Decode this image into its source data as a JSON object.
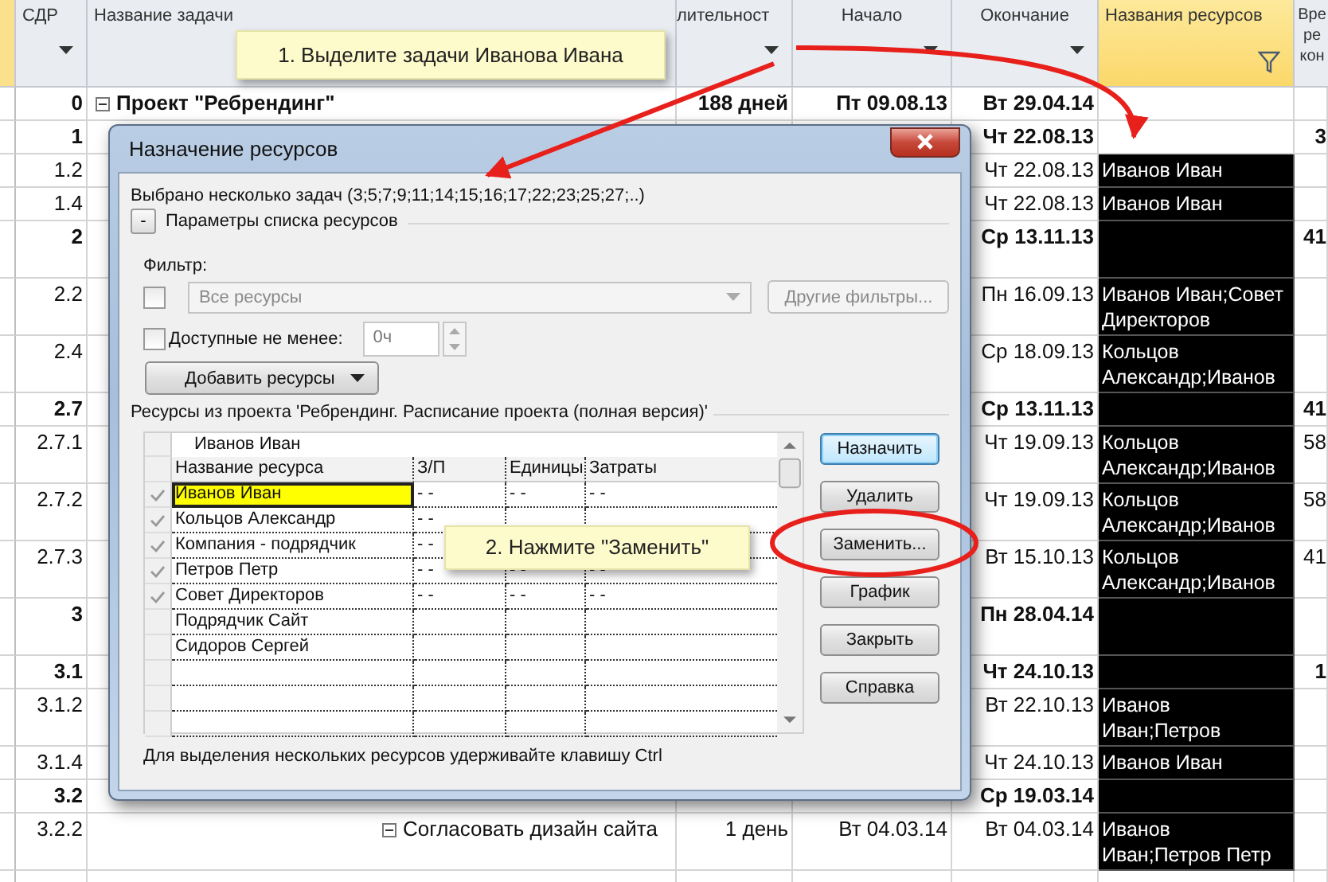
{
  "columns": [
    {
      "kind": "corner"
    },
    {
      "kind": "wbs",
      "label": "СДР",
      "menu": true
    },
    {
      "kind": "name",
      "label": "Название задачи"
    },
    {
      "kind": "duration",
      "label": "лительност",
      "menu": true
    },
    {
      "kind": "start",
      "label": "Начало",
      "menu": true
    },
    {
      "kind": "end",
      "label": "Окончание",
      "menu": true
    },
    {
      "kind": "resources",
      "label": "Названия ресурсов",
      "filtered": true
    },
    {
      "kind": "extra",
      "label": "Вре ре кон"
    }
  ],
  "rows": [
    {
      "wbs": "0",
      "summary": true,
      "name": "Проект \"Ребрендинг\"",
      "duration": "188 дней",
      "start": "Пт 09.08.13",
      "end": "Вт 29.04.14",
      "selected": false
    },
    {
      "wbs": "1",
      "summary": true,
      "end": "Чт 22.08.13",
      "extra": "3",
      "selected": false
    },
    {
      "wbs": "1.2",
      "summary": false,
      "end": "Чт 22.08.13",
      "resources": "Иванов Иван",
      "selected": true
    },
    {
      "wbs": "1.4",
      "summary": false,
      "end": "Чт 22.08.13",
      "resources": "Иванов Иван",
      "selected": true
    },
    {
      "wbs": "2",
      "summary": true,
      "end": "Ср 13.11.13",
      "extra": "41",
      "selected": true
    },
    {
      "wbs": "2.2",
      "summary": false,
      "end": "Пн 16.09.13",
      "resources": "Иванов Иван;Совет Директоров",
      "selected": true
    },
    {
      "wbs": "2.4",
      "summary": false,
      "end": "Ср 18.09.13",
      "resources": "Кольцов Александр;Иванов",
      "selected": true
    },
    {
      "wbs": "2.7",
      "summary": true,
      "end": "Ср 13.11.13",
      "extra": "41",
      "selected": true
    },
    {
      "wbs": "2.7.1",
      "summary": false,
      "end": "Чт 19.09.13",
      "resources": "Кольцов Александр;Иванов",
      "extra": "58",
      "selected": true
    },
    {
      "wbs": "2.7.2",
      "summary": false,
      "end": "Чт 19.09.13",
      "resources": "Кольцов Александр;Иванов",
      "extra": "58",
      "selected": true
    },
    {
      "wbs": "2.7.3",
      "summary": false,
      "end": "Вт 15.10.13",
      "resources": "Кольцов Александр;Иванов",
      "extra": "41",
      "selected": true
    },
    {
      "wbs": "3",
      "summary": true,
      "end": "Пн 28.04.14",
      "selected": true
    },
    {
      "wbs": "3.1",
      "summary": true,
      "end": "Чт 24.10.13",
      "extra": "1",
      "selected": true
    },
    {
      "wbs": "3.1.2",
      "summary": false,
      "end": "Вт 22.10.13",
      "resources": "Иванов Иван;Петров",
      "selected": true
    },
    {
      "wbs": "3.1.4",
      "summary": false,
      "end": "Чт 24.10.13",
      "resources": "Иванов Иван",
      "selected": true
    },
    {
      "wbs": "3.2",
      "summary": true,
      "end": "Ср 19.03.14",
      "selected": true
    },
    {
      "wbs": "3.2.2",
      "summary": false,
      "name": "Согласовать дизайн сайта",
      "duration": "1 день",
      "start": "Вт 04.03.14",
      "end": "Вт 04.03.14",
      "resources": "Иванов Иван;Петров Петр",
      "selected": true
    }
  ],
  "dialog": {
    "title": "Назначение ресурсов",
    "selection_info": "Выбрано несколько задач (3;5;7;9;11;14;15;16;17;22;23;25;27;..)",
    "options_toggle": "-",
    "options_label": "Параметры списка ресурсов",
    "filter_label": "Фильтр:",
    "filter_checked": false,
    "filter_value": "Все ресурсы",
    "filter_disabled": true,
    "more_filters": "Другие фильтры...",
    "available_label": "Доступные не менее:",
    "available_checked": false,
    "available_value": "0ч",
    "add_button": "Добавить ресурсы",
    "list_label": "Ресурсы из проекта 'Ребрендинг. Расписание проекта (полная версия)'",
    "entry_value": "Иванов Иван",
    "columns": [
      "Название ресурса",
      "З/П",
      "Единицы",
      "Затраты"
    ],
    "resources": [
      {
        "name": "Иванов Иван",
        "assigned": true,
        "selected": true,
        "rate": "- -",
        "units": "- -",
        "cost": "- -"
      },
      {
        "name": "Кольцов Александр",
        "assigned": true,
        "selected": false,
        "rate": "- -"
      },
      {
        "name": "Компания - подрядчик",
        "assigned": true,
        "selected": false,
        "rate": "- -"
      },
      {
        "name": "Петров Петр",
        "assigned": true,
        "selected": false,
        "rate": "- -",
        "units": "- -",
        "cost": "- -"
      },
      {
        "name": "Совет Директоров",
        "assigned": true,
        "selected": false,
        "rate": "- -",
        "units": "- -",
        "cost": "- -"
      },
      {
        "name": "Подрядчик Сайт",
        "assigned": false,
        "selected": false
      },
      {
        "name": "Сидоров Сергей",
        "assigned": false,
        "selected": false
      }
    ],
    "buttons": [
      {
        "label": "Назначить",
        "default": true
      },
      {
        "label": "Удалить",
        "default": false
      },
      {
        "label": "Заменить...",
        "default": false
      },
      {
        "label": "График",
        "default": false
      },
      {
        "label": "Закрыть",
        "default": false
      },
      {
        "label": "Справка",
        "default": false
      }
    ],
    "hint": "Для выделения нескольких ресурсов удерживайте клавишу Ctrl"
  },
  "callouts": [
    "1. Выделите задачи Иванова Ивана",
    "2. Нажмите \"Заменить\""
  ]
}
